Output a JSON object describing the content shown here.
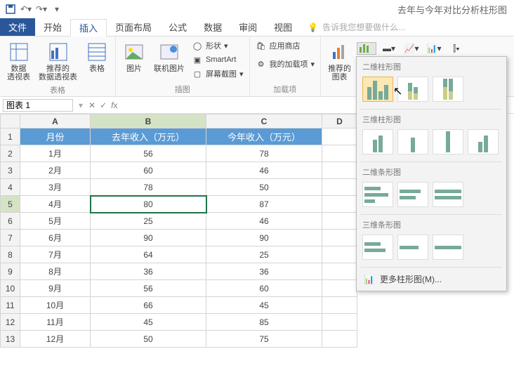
{
  "titlebar": {
    "title": "去年与今年对比分析柱形图"
  },
  "tabs": {
    "file": "文件",
    "items": [
      "开始",
      "插入",
      "页面布局",
      "公式",
      "数据",
      "审阅",
      "视图"
    ],
    "active_index": 1,
    "tell_me": "告诉我您想要做什么..."
  },
  "ribbon": {
    "tables": {
      "label": "表格",
      "pivot": "数据\n透视表",
      "rec_pivot": "推荐的\n数据透视表",
      "table": "表格"
    },
    "illus": {
      "label": "插图",
      "pic": "图片",
      "online_pic": "联机图片",
      "shapes": "形状",
      "smartart": "SmartArt",
      "screenshot": "屏幕截图"
    },
    "addins": {
      "label": "加载项",
      "store": "应用商店",
      "my": "我的加载项"
    },
    "charts": {
      "label": "图表",
      "rec": "推荐的\n图表"
    }
  },
  "namebox": {
    "value": "图表 1"
  },
  "sheet": {
    "cols": [
      "A",
      "B",
      "C",
      "D"
    ],
    "headers": [
      "月份",
      "去年收入（万元）",
      "今年收入（万元）"
    ],
    "rows": [
      [
        "1月",
        "56",
        "78"
      ],
      [
        "2月",
        "60",
        "46"
      ],
      [
        "3月",
        "78",
        "50"
      ],
      [
        "4月",
        "80",
        "87"
      ],
      [
        "5月",
        "25",
        "46"
      ],
      [
        "6月",
        "90",
        "90"
      ],
      [
        "7月",
        "64",
        "25"
      ],
      [
        "8月",
        "36",
        "36"
      ],
      [
        "9月",
        "56",
        "60"
      ],
      [
        "10月",
        "66",
        "45"
      ],
      [
        "11月",
        "45",
        "85"
      ],
      [
        "12月",
        "50",
        "75"
      ]
    ],
    "selected": {
      "row": 5,
      "col": "B"
    }
  },
  "chart_popup": {
    "sec1": "二维柱形图",
    "sec2": "三维柱形图",
    "sec3": "二维条形图",
    "sec4": "三维条形图",
    "more": "更多柱形图(M)..."
  },
  "chart_data": {
    "type": "bar",
    "title": "去年与今年对比分析柱形图",
    "categories": [
      "1月",
      "2月",
      "3月",
      "4月",
      "5月",
      "6月",
      "7月",
      "8月",
      "9月",
      "10月",
      "11月",
      "12月"
    ],
    "series": [
      {
        "name": "去年收入（万元）",
        "values": [
          56,
          60,
          78,
          80,
          25,
          90,
          64,
          36,
          56,
          66,
          45,
          50
        ]
      },
      {
        "name": "今年收入（万元）",
        "values": [
          78,
          46,
          50,
          87,
          46,
          90,
          25,
          36,
          60,
          45,
          85,
          75
        ]
      }
    ],
    "xlabel": "月份",
    "ylabel": "收入（万元）"
  }
}
